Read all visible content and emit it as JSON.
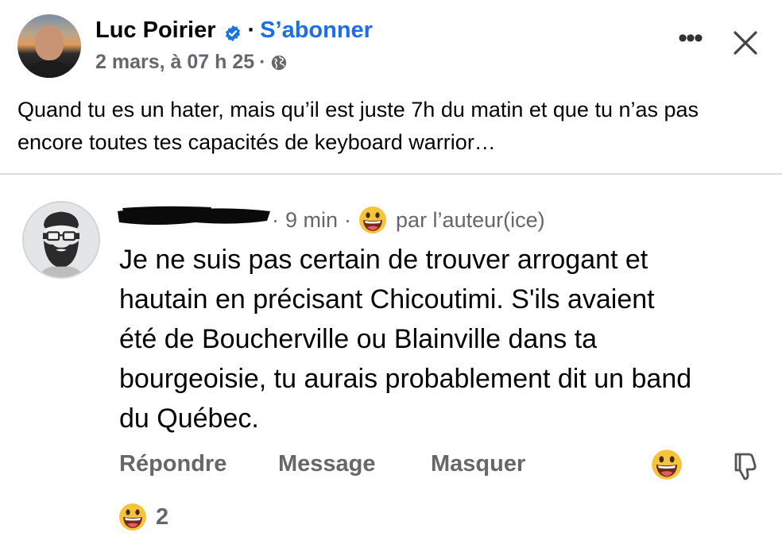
{
  "post": {
    "author_name": "Luc Poirier",
    "follow_label": "S’abonner",
    "timestamp": "2 mars, à 07 h 25",
    "meta_separator": "·",
    "body": "Quand tu es un hater, mais qu’il est juste 7h du matin et que tu n’as pas encore toutes tes capacités de keyboard warrior…",
    "icons": {
      "verified": "verified-badge-icon",
      "audience": "globe-icon",
      "more": "more-options-icon",
      "close": "close-icon"
    },
    "more_label": "•••"
  },
  "comment": {
    "time": "9 min",
    "separator": "·",
    "author_badge": "par l’auteur(ice)",
    "text": "Je ne suis pas certain de trouver arrogant et\nhautain en précisant Chicoutimi.  S'ils avaient\nété de Boucherville ou Blainville dans ta\nbourgeoisie, tu aurais probablement dit un band\ndu Québec.",
    "actions": {
      "reply": "Répondre",
      "message": "Message",
      "hide": "Masquer"
    },
    "reaction_count": "2",
    "icons": {
      "reaction": "grinning-emoji-icon",
      "dislike": "thumbs-down-icon"
    }
  },
  "colors": {
    "link": "#1b6ee6",
    "secondary_text": "#65676b",
    "divider": "#dcdcdc"
  }
}
